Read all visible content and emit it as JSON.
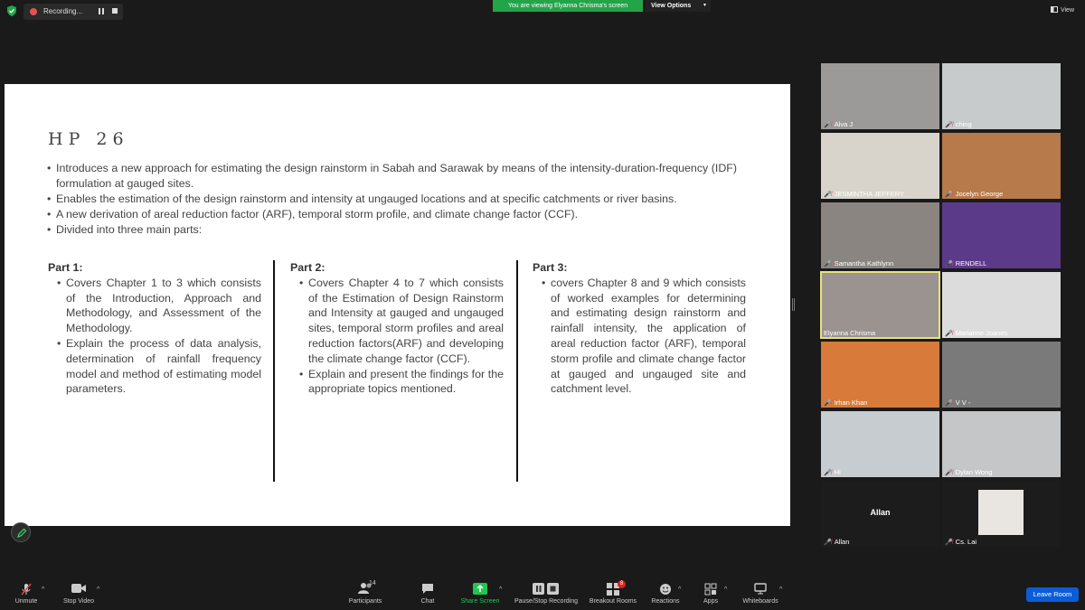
{
  "topbar": {
    "recording_label": "Recording...",
    "viewing_banner": "You are viewing Elyanna Chrisma's screen",
    "view_options_label": "View Options",
    "view_label": "View"
  },
  "slide": {
    "title": "HP 26",
    "bullets": [
      "Introduces a new approach for estimating the design rainstorm in Sabah and Sarawak by means of the intensity-duration-frequency (IDF) formulation at gauged sites.",
      "Enables the estimation of the design rainstorm and intensity at ungauged locations and at specific catchments or river basins.",
      "A new derivation of areal reduction factor (ARF), temporal storm profile, and climate change factor (CCF).",
      "Divided into three main parts:"
    ],
    "parts": [
      {
        "heading": "Part 1:",
        "items": [
          "Covers Chapter 1 to 3 which consists of the Introduction, Approach and Methodology, and Assessment of the Methodology.",
          "Explain the process of data analysis, determination of rainfall frequency model and method of estimating model parameters."
        ]
      },
      {
        "heading": "Part 2:",
        "items": [
          "Covers Chapter 4 to 7 which consists of the Estimation of Design Rainstorm and Intensity at gauged and ungauged sites, temporal storm profiles and areal reduction factors(ARF) and developing the climate change factor (CCF).",
          "Explain and present the findings for the appropriate topics mentioned."
        ]
      },
      {
        "heading": "Part 3:",
        "items": [
          "covers Chapter 8 and 9 which consists of worked examples for determining and estimating design rainstorm and rainfall intensity, the application of areal reduction factor (ARF), temporal storm profile and climate change factor at gauged and ungauged site and catchment level."
        ]
      }
    ]
  },
  "participants": [
    {
      "name": "Alva J",
      "bg": "#9c9a98",
      "muted": true
    },
    {
      "name": "ching",
      "bg": "#c8cbcc",
      "muted": true
    },
    {
      "name": "JESMINTHA JEFFERY",
      "bg": "#d8d4cc",
      "muted": true
    },
    {
      "name": "Jocelyn George",
      "bg": "#b77a4a",
      "muted": true
    },
    {
      "name": "Samantha Kathlynn",
      "bg": "#8a8580",
      "muted": true
    },
    {
      "name": "RENDELL",
      "bg": "#5c3a8a",
      "muted": true
    },
    {
      "name": "Elyanna Chrisma",
      "bg": "#9b9390",
      "muted": false,
      "active": true
    },
    {
      "name": "Marianne Joanes",
      "bg": "#dcdcdc",
      "muted": true
    },
    {
      "name": "Irhan Khan",
      "bg": "#d77a3a",
      "muted": true
    },
    {
      "name": "V V -",
      "bg": "#7a7a7a",
      "muted": true
    },
    {
      "name": "Hi",
      "bg": "#c7ccd0",
      "muted": true
    },
    {
      "name": "Dylan Wong",
      "bg": "#c4c6c8",
      "muted": true
    },
    {
      "name": "Allan",
      "bg": "#1c1c1c",
      "muted": true,
      "center_name": "Allan"
    },
    {
      "name": "Cs. Lai",
      "bg": "#1c1c1c",
      "muted": true
    }
  ],
  "toolbar": {
    "unmute": "Unmute",
    "stop_video": "Stop Video",
    "participants": "Participants",
    "participants_count": "14",
    "chat": "Chat",
    "share_screen": "Share Screen",
    "pause_stop_recording": "Pause/Stop Recording",
    "breakout_rooms": "Breakout Rooms",
    "breakout_badge": "8",
    "reactions": "Reactions",
    "apps": "Apps",
    "whiteboards": "Whiteboards",
    "leave_room": "Leave Room"
  },
  "colors": {
    "banner_green": "#23a448",
    "leave_blue": "#0b5cd7",
    "share_green": "#23c552",
    "muted_red": "#e64444",
    "active_outline": "#e8e27a"
  }
}
